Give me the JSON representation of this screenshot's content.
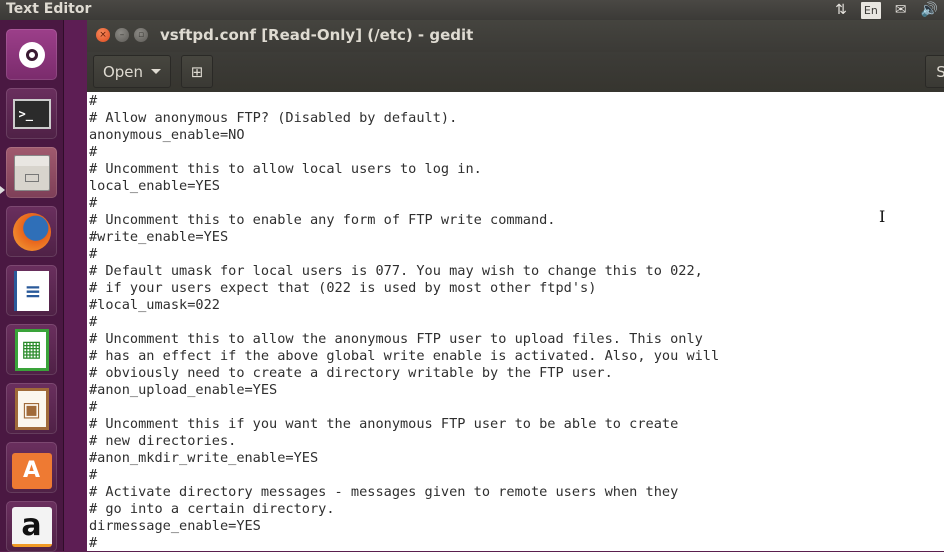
{
  "top_panel": {
    "app_title": "Text Editor",
    "indicators": [
      {
        "name": "network-icon",
        "glyph": "⇅"
      },
      {
        "name": "keyboard-language",
        "label": "En"
      },
      {
        "name": "mail-icon",
        "glyph": "✉"
      },
      {
        "name": "volume-icon",
        "glyph": "🔊"
      }
    ]
  },
  "launcher": {
    "items": [
      {
        "name": "ubuntu-dash",
        "glyph": "◎"
      },
      {
        "name": "terminal",
        "glyph": ">_"
      },
      {
        "name": "files",
        "glyph": "▭"
      },
      {
        "name": "firefox",
        "glyph": "●"
      },
      {
        "name": "libreoffice-writer",
        "glyph": "≡"
      },
      {
        "name": "libreoffice-calc",
        "glyph": "▦"
      },
      {
        "name": "libreoffice-impress",
        "glyph": "▣"
      },
      {
        "name": "software-center",
        "glyph": "A"
      },
      {
        "name": "amazon",
        "glyph": "a"
      }
    ]
  },
  "window": {
    "title": "vsftpd.conf [Read-Only] (/etc) - gedit",
    "close_glyph": "×",
    "min_glyph": "–",
    "max_glyph": "▫",
    "toolbar": {
      "open_label": "Open",
      "new_tab_glyph": "⊞",
      "search_glyph": "S"
    }
  },
  "editor": {
    "lines": [
      "#",
      "# Allow anonymous FTP? (Disabled by default).",
      "anonymous_enable=NO",
      "#",
      "# Uncomment this to allow local users to log in.",
      "local_enable=YES",
      "#",
      "# Uncomment this to enable any form of FTP write command.",
      "#write_enable=YES",
      "#",
      "# Default umask for local users is 077. You may wish to change this to 022,",
      "# if your users expect that (022 is used by most other ftpd's)",
      "#local_umask=022",
      "#",
      "# Uncomment this to allow the anonymous FTP user to upload files. This only",
      "# has an effect if the above global write enable is activated. Also, you will",
      "# obviously need to create a directory writable by the FTP user.",
      "#anon_upload_enable=YES",
      "#",
      "# Uncomment this if you want the anonymous FTP user to be able to create",
      "# new directories.",
      "#anon_mkdir_write_enable=YES",
      "#",
      "# Activate directory messages - messages given to remote users when they",
      "# go into a certain directory.",
      "dirmessage_enable=YES",
      "#"
    ],
    "mouse_cursor": "I"
  }
}
